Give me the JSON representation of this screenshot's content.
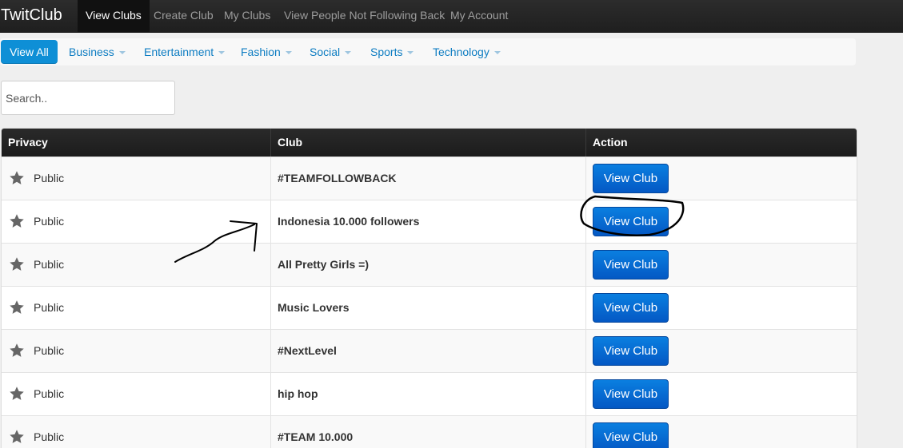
{
  "navbar": {
    "brand": "TwitClub",
    "items": [
      {
        "label": "View Clubs",
        "active": true
      },
      {
        "label": "Create Club"
      },
      {
        "label": "My Clubs"
      },
      {
        "label": "View People Not Following Back"
      },
      {
        "label": "My Account"
      }
    ]
  },
  "categories": [
    {
      "label": "View All",
      "active": true
    },
    {
      "label": "Business"
    },
    {
      "label": "Entertainment"
    },
    {
      "label": "Fashion"
    },
    {
      "label": "Social"
    },
    {
      "label": "Sports"
    },
    {
      "label": "Technology"
    }
  ],
  "search": {
    "placeholder": "Search.."
  },
  "table": {
    "headers": [
      "Privacy",
      "Club",
      "Action"
    ],
    "rows": [
      {
        "privacy": "Public",
        "club": "#TEAMFOLLOWBACK",
        "action": "View Club"
      },
      {
        "privacy": "Public",
        "club": "Indonesia 10.000 followers",
        "action": "View Club"
      },
      {
        "privacy": "Public",
        "club": "All Pretty Girls =)",
        "action": "View Club"
      },
      {
        "privacy": "Public",
        "club": "Music Lovers",
        "action": "View Club"
      },
      {
        "privacy": "Public",
        "club": "#NextLevel",
        "action": "View Club"
      },
      {
        "privacy": "Public",
        "club": "hip hop",
        "action": "View Club"
      },
      {
        "privacy": "Public",
        "club": "#TEAM 10.000",
        "action": "View Club"
      }
    ]
  },
  "colors": {
    "navbar_bg": "#222222",
    "link": "#0e7dc2",
    "button": "#0a6fd8",
    "active_category": "#0e8fd6"
  },
  "icons": {
    "privacy": "star-icon",
    "dropdown": "caret-down-icon"
  }
}
